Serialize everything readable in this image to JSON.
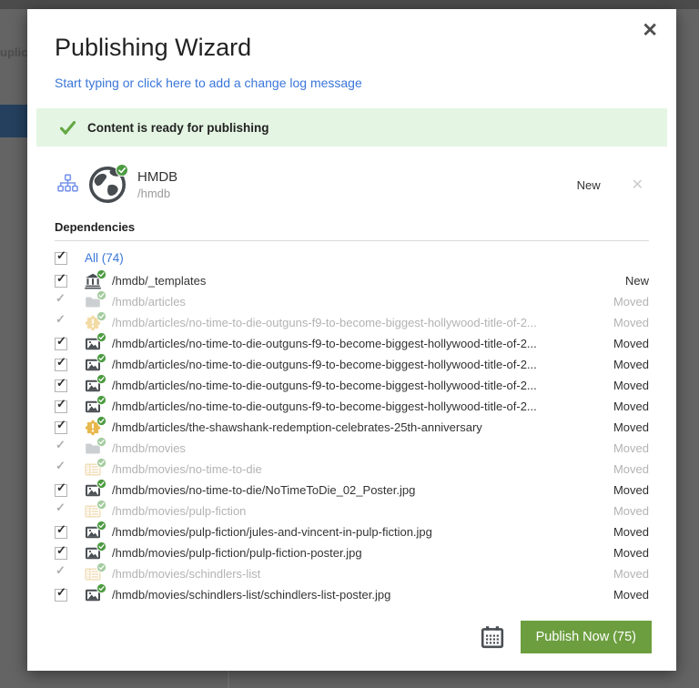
{
  "background": {
    "partial_text": "uplica"
  },
  "modal": {
    "title": "Publishing Wizard",
    "close_glyph": "✕",
    "changelog_link": "Start typing or click here to add a change log message",
    "banner": {
      "text": "Content is ready for publishing"
    },
    "root_item": {
      "name": "HMDB",
      "path": "/hmdb",
      "status": "New",
      "remove_glyph": "✕"
    },
    "dependencies": {
      "header": "Dependencies",
      "select_all": "All (74)",
      "check_glyph": "✓",
      "rows": [
        {
          "icon": "templates",
          "path": "/hmdb/_templates",
          "status": "New",
          "checked": true,
          "enabled": true
        },
        {
          "icon": "folder",
          "path": "/hmdb/articles",
          "status": "Moved",
          "checked": true,
          "enabled": false
        },
        {
          "icon": "warning",
          "path": "/hmdb/articles/no-time-to-die-outguns-f9-to-become-biggest-hollywood-title-of-2...",
          "status": "Moved",
          "checked": true,
          "enabled": false
        },
        {
          "icon": "image",
          "path": "/hmdb/articles/no-time-to-die-outguns-f9-to-become-biggest-hollywood-title-of-2...",
          "status": "Moved",
          "checked": true,
          "enabled": true
        },
        {
          "icon": "image",
          "path": "/hmdb/articles/no-time-to-die-outguns-f9-to-become-biggest-hollywood-title-of-2...",
          "status": "Moved",
          "checked": true,
          "enabled": true
        },
        {
          "icon": "image",
          "path": "/hmdb/articles/no-time-to-die-outguns-f9-to-become-biggest-hollywood-title-of-2...",
          "status": "Moved",
          "checked": true,
          "enabled": true
        },
        {
          "icon": "image",
          "path": "/hmdb/articles/no-time-to-die-outguns-f9-to-become-biggest-hollywood-title-of-2...",
          "status": "Moved",
          "checked": true,
          "enabled": true
        },
        {
          "icon": "warning",
          "path": "/hmdb/articles/the-shawshank-redemption-celebrates-25th-anniversary",
          "status": "Moved",
          "checked": true,
          "enabled": true
        },
        {
          "icon": "folder",
          "path": "/hmdb/movies",
          "status": "Moved",
          "checked": true,
          "enabled": false
        },
        {
          "icon": "film",
          "path": "/hmdb/movies/no-time-to-die",
          "status": "Moved",
          "checked": true,
          "enabled": false
        },
        {
          "icon": "image",
          "path": "/hmdb/movies/no-time-to-die/NoTimeToDie_02_Poster.jpg",
          "status": "Moved",
          "checked": true,
          "enabled": true
        },
        {
          "icon": "film",
          "path": "/hmdb/movies/pulp-fiction",
          "status": "Moved",
          "checked": true,
          "enabled": false
        },
        {
          "icon": "image",
          "path": "/hmdb/movies/pulp-fiction/jules-and-vincent-in-pulp-fiction.jpg",
          "status": "Moved",
          "checked": true,
          "enabled": true
        },
        {
          "icon": "image",
          "path": "/hmdb/movies/pulp-fiction/pulp-fiction-poster.jpg",
          "status": "Moved",
          "checked": true,
          "enabled": true
        },
        {
          "icon": "film",
          "path": "/hmdb/movies/schindlers-list",
          "status": "Moved",
          "checked": true,
          "enabled": false
        },
        {
          "icon": "image",
          "path": "/hmdb/movies/schindlers-list/schindlers-list-poster.jpg",
          "status": "Moved",
          "checked": true,
          "enabled": true
        }
      ]
    },
    "footer": {
      "publish_label": "Publish Now (75)"
    }
  },
  "colors": {
    "accent_green": "#6c9e3f",
    "banner_bg": "#e4f6e3",
    "link_blue": "#3a76d8",
    "badge_green": "#4c9b41",
    "icon_dark": "#4a4f54",
    "icon_orange": "#e8b84d"
  }
}
